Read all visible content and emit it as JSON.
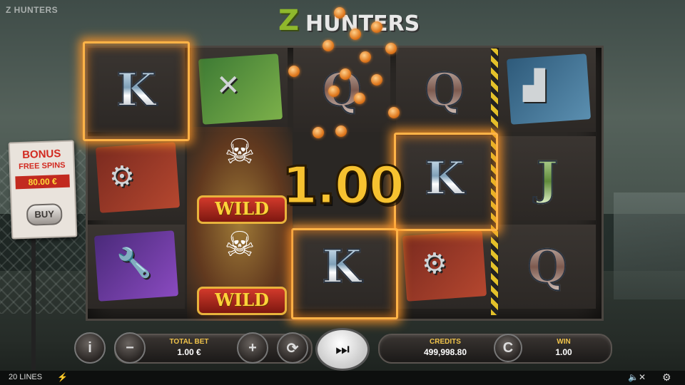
{
  "brand": "Z HUNTERS",
  "logo": {
    "z": "Z",
    "word": "HUNTERS"
  },
  "reels": {
    "symbols": {
      "r1c1": "K",
      "r1c3": "Q",
      "r1c4": "Q",
      "r2c5": "K",
      "r2c6": "J",
      "r3c4": "K",
      "r3c6": "Q"
    },
    "icons": [
      "uzi-icon",
      "kunai-icon",
      "chainsaw-icon",
      "wrench-icon",
      "skull-wild-icon"
    ]
  },
  "wild": {
    "label1": "WILD",
    "label2": "WILD"
  },
  "win_amount": "1.00",
  "bonus": {
    "line1": "BONUS",
    "line2": "FREE SPINS",
    "price": "80.00 €",
    "buy_label": "BUY"
  },
  "controls": {
    "info": "i",
    "minus": "−",
    "total_bet_label": "TOTAL BET",
    "total_bet_value": "1.00 €",
    "plus": "+",
    "credits_label": "CREDITS",
    "credits_value": "499,998.80",
    "currency_toggle": "C",
    "win_label": "WIN",
    "win_value": "1.00"
  },
  "status": {
    "lines": "20 LINES"
  },
  "colors": {
    "accent": "#f6c230",
    "glow": "#ffb347",
    "wild_red": "#d23a2b"
  }
}
